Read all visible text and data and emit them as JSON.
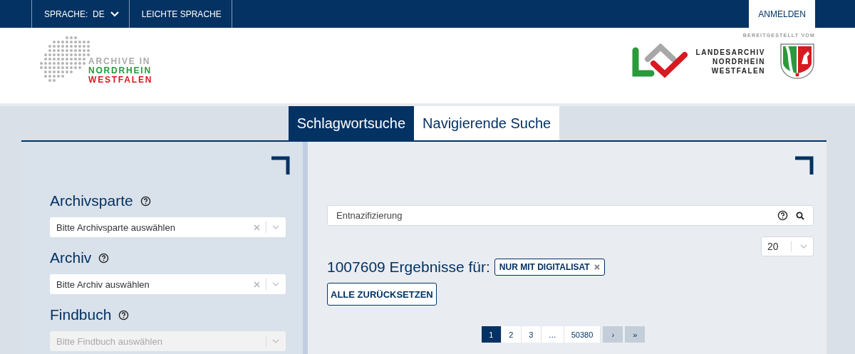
{
  "top_bar": {
    "language_label": "SPRACHE:",
    "language_value": "DE",
    "easy_language": "LEICHTE SPRACHE",
    "login": "ANMELDEN"
  },
  "header": {
    "logo_lines": [
      "ARCHIVE IN",
      "NORDRHEIN",
      "WESTFALEN"
    ],
    "provided_by": "BEREITGESTELLT VOM",
    "partner_lines": [
      "LANDESARCHIV",
      "NORDRHEIN",
      "WESTFALEN"
    ]
  },
  "tabs": [
    {
      "label": "Schlagwortsuche",
      "selected": true
    },
    {
      "label": "Navigierende Suche",
      "selected": false
    }
  ],
  "filters": [
    {
      "label": "Archivsparte",
      "placeholder": "Bitte Archivsparte auswählen",
      "disabled": false
    },
    {
      "label": "Archiv",
      "placeholder": "Bitte Archiv auswählen",
      "disabled": false
    },
    {
      "label": "Findbuch",
      "placeholder": "Bitte Findbuch auswählen",
      "disabled": true
    }
  ],
  "search": {
    "value": "Entnazifizierung"
  },
  "page_size": "20",
  "results": {
    "count_text": "1007609 Ergebnisse für:",
    "filter_tag": "NUR MIT DIGITALISAT",
    "reset": "ALLE ZURÜCKSETZEN"
  },
  "pagination": [
    {
      "label": "1",
      "kind": "page",
      "selected": true
    },
    {
      "label": "2",
      "kind": "page",
      "selected": false
    },
    {
      "label": "3",
      "kind": "page",
      "selected": false
    },
    {
      "label": "…",
      "kind": "page",
      "selected": false
    },
    {
      "label": "50380",
      "kind": "page",
      "selected": false
    },
    {
      "label": "›",
      "kind": "nav",
      "selected": false
    },
    {
      "label": "»",
      "kind": "nav",
      "selected": false
    }
  ]
}
